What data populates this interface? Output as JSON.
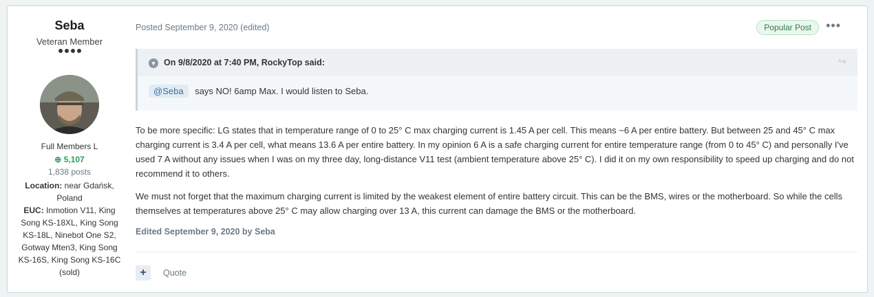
{
  "author": {
    "name": "Seba",
    "title": "Veteran Member",
    "group": "Full Members L",
    "reputation": "5,107",
    "posts": "1,838 posts",
    "location_label": "Location:",
    "location_value": "near Gdańsk, Poland",
    "euc_label": "EUC:",
    "euc_value": "Inmotion V11, King Song KS-18XL, King Song KS-18L, Ninebot One S2, Gotway Mten3, King Song KS-16S, King Song KS-16C (sold)"
  },
  "post": {
    "posted": "Posted September 9, 2020 (edited)",
    "badge": "Popular Post",
    "more_icon": "•••",
    "quote": {
      "citation": "On 9/8/2020 at 7:40 PM, RockyTop said:",
      "mention": "@Seba",
      "text": "says NO! 6amp Max. I would listen to Seba."
    },
    "paragraphs": [
      "To be more specific: LG states that in temperature range of 0 to 25° C max charging current is 1.45 A per cell. This means ~6 A per entire battery. But between 25 and 45° C max charging current is 3.4 A per cell, what means 13.6 A per entire battery. In my opinion 6 A is a safe charging current for entire temperature range (from 0 to 45° C) and personally I've used 7 A without any issues when I was on my three day, long-distance V11 test (ambient temperature above 25° C). I did it on my own responsibility to speed up charging and do not recommend it to others.",
      "We must not forget that the maximum charging current is limited by the weakest element of entire battery circuit. This can be the BMS, wires or the motherboard. So while the cells themselves at temperatures above 25° C may allow charging over 13 A, this current can damage the BMS or the motherboard."
    ],
    "edited": "Edited September 9, 2020 by Seba",
    "actions": {
      "plus": "+",
      "quote": "Quote"
    }
  }
}
